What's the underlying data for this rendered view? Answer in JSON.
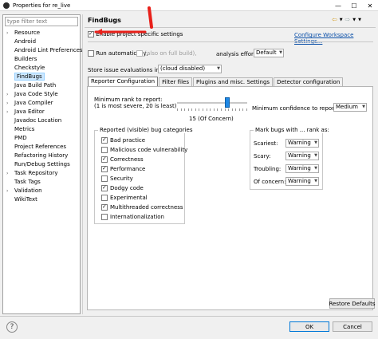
{
  "window": {
    "title": "Properties for re_live",
    "minimize": "—",
    "maximize": "☐",
    "close": "✕"
  },
  "sidebar": {
    "filter_placeholder": "type filter text",
    "items": [
      {
        "label": "Resource",
        "expandable": true,
        "selected": false
      },
      {
        "label": "Android",
        "expandable": false,
        "selected": false
      },
      {
        "label": "Android Lint Preferences",
        "expandable": false,
        "selected": false
      },
      {
        "label": "Builders",
        "expandable": false,
        "selected": false
      },
      {
        "label": "Checkstyle",
        "expandable": false,
        "selected": false
      },
      {
        "label": "FindBugs",
        "expandable": false,
        "selected": true
      },
      {
        "label": "Java Build Path",
        "expandable": false,
        "selected": false
      },
      {
        "label": "Java Code Style",
        "expandable": true,
        "selected": false
      },
      {
        "label": "Java Compiler",
        "expandable": true,
        "selected": false
      },
      {
        "label": "Java Editor",
        "expandable": true,
        "selected": false
      },
      {
        "label": "Javadoc Location",
        "expandable": false,
        "selected": false
      },
      {
        "label": "Metrics",
        "expandable": false,
        "selected": false
      },
      {
        "label": "PMD",
        "expandable": false,
        "selected": false
      },
      {
        "label": "Project References",
        "expandable": false,
        "selected": false
      },
      {
        "label": "Refactoring History",
        "expandable": false,
        "selected": false
      },
      {
        "label": "Run/Debug Settings",
        "expandable": false,
        "selected": false
      },
      {
        "label": "Task Repository",
        "expandable": true,
        "selected": false
      },
      {
        "label": "Task Tags",
        "expandable": false,
        "selected": false
      },
      {
        "label": "Validation",
        "expandable": true,
        "selected": false
      },
      {
        "label": "WikiText",
        "expandable": false,
        "selected": false
      }
    ]
  },
  "page": {
    "title": "FindBugs",
    "enable_label": "Enable project specific settings",
    "configure_link": "Configure Workspace Settings...",
    "run_auto_label": "Run automatically,",
    "also_full_build_label": "(also on full build),",
    "analysis_effort_label": "analysis effort",
    "analysis_effort_value": "Default",
    "store_issue_label": "Store issue evaluations in:",
    "store_issue_value": "(cloud disabled)"
  },
  "tabs": [
    {
      "label": "Reporter Configuration",
      "active": true
    },
    {
      "label": "Filter files",
      "active": false
    },
    {
      "label": "Plugins and misc. Settings",
      "active": false
    },
    {
      "label": "Detector configuration",
      "active": false
    }
  ],
  "reporter": {
    "min_rank_label": "Minimum rank to report:",
    "min_rank_hint": "(1 is most severe, 20 is least)",
    "rank_value_text": "15 (Of Concern)",
    "rank_value": 15,
    "rank_min": 1,
    "rank_max": 20,
    "min_confidence_label": "Minimum confidence to report:",
    "min_confidence_value": "Medium",
    "categories_title": "Reported (visible) bug categories",
    "categories": [
      {
        "label": "Bad practice",
        "checked": true
      },
      {
        "label": "Malicious code vulnerability",
        "checked": false
      },
      {
        "label": "Correctness",
        "checked": true
      },
      {
        "label": "Performance",
        "checked": true
      },
      {
        "label": "Security",
        "checked": false
      },
      {
        "label": "Dodgy code",
        "checked": true
      },
      {
        "label": "Experimental",
        "checked": false
      },
      {
        "label": "Multithreaded correctness",
        "checked": true
      },
      {
        "label": "Internationalization",
        "checked": false
      }
    ],
    "mark_title": "Mark bugs with ... rank as:",
    "marks": [
      {
        "label": "Scariest:",
        "value": "Warning"
      },
      {
        "label": "Scary:",
        "value": "Warning"
      },
      {
        "label": "Troubling:",
        "value": "Warning"
      },
      {
        "label": "Of concern:",
        "value": "Warning"
      }
    ],
    "restore_label": "Restore Defaults"
  },
  "footer": {
    "help": "?",
    "ok_label": "OK",
    "cancel_label": "Cancel"
  },
  "colors": {
    "selection": "#cde8ff",
    "slider_thumb": "#1e88e5",
    "link": "#0a4fa8",
    "annotation_arrow": "#e8201a"
  }
}
